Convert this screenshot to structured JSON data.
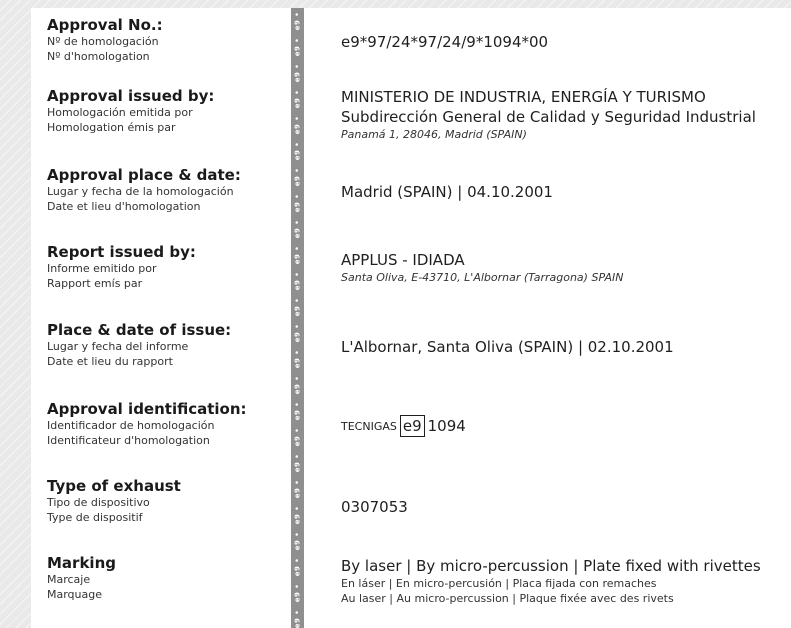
{
  "rows": [
    {
      "label": "Approval No.:",
      "sub": [
        "Nº de homologación",
        "Nº d'homologation"
      ],
      "value": "e9*97/24*97/24/9*1094*00"
    },
    {
      "label": "Approval issued by:",
      "sub": [
        "Homologación emitida por",
        "Homologation émis par"
      ],
      "value_lines": [
        "MINISTERIO DE INDUSTRIA, ENERGÍA Y TURISMO",
        "Subdirección General de Calidad y Seguridad Industrial"
      ],
      "address": "Panamá 1, 28046, Madrid (SPAIN)"
    },
    {
      "label": "Approval place & date:",
      "sub": [
        "Lugar y fecha de la homologación",
        "Date et lieu d'homologation"
      ],
      "value": "Madrid (SPAIN) | 04.10.2001"
    },
    {
      "label": "Report issued by:",
      "sub": [
        "Informe emitido por",
        "Rapport emís par"
      ],
      "value": "APPLUS - IDIADA",
      "address": "Santa Oliva, E-43710, L'Albornar (Tarragona) SPAIN"
    },
    {
      "label": "Place & date of issue:",
      "sub": [
        "Lugar y fecha del informe",
        "Date et lieu du rapport"
      ],
      "value": "L'Albornar, Santa Oliva (SPAIN) | 02.10.2001"
    },
    {
      "label": "Approval identification:",
      "sub": [
        "Identificador de homologación",
        "Identificateur d'homologation"
      ],
      "ident": {
        "brand": "TECNIGAS",
        "mark": "e9",
        "number": "1094"
      }
    },
    {
      "label": "Type of exhaust",
      "sub": [
        "Tipo de dispositivo",
        "Type de dispositif"
      ],
      "value": "0307053"
    },
    {
      "label": "Marking",
      "sub": [
        "Marcaje",
        "Marquage"
      ],
      "value": "By laser | By micro-percussion | Plate fixed with rivettes",
      "value_sub": [
        "En láser | En micro-percusión | Placa fijada con remaches",
        "Au laser | Au micro-percussion | Plaque fixée avec des rivets"
      ]
    }
  ],
  "divider_mark": "e9 •"
}
